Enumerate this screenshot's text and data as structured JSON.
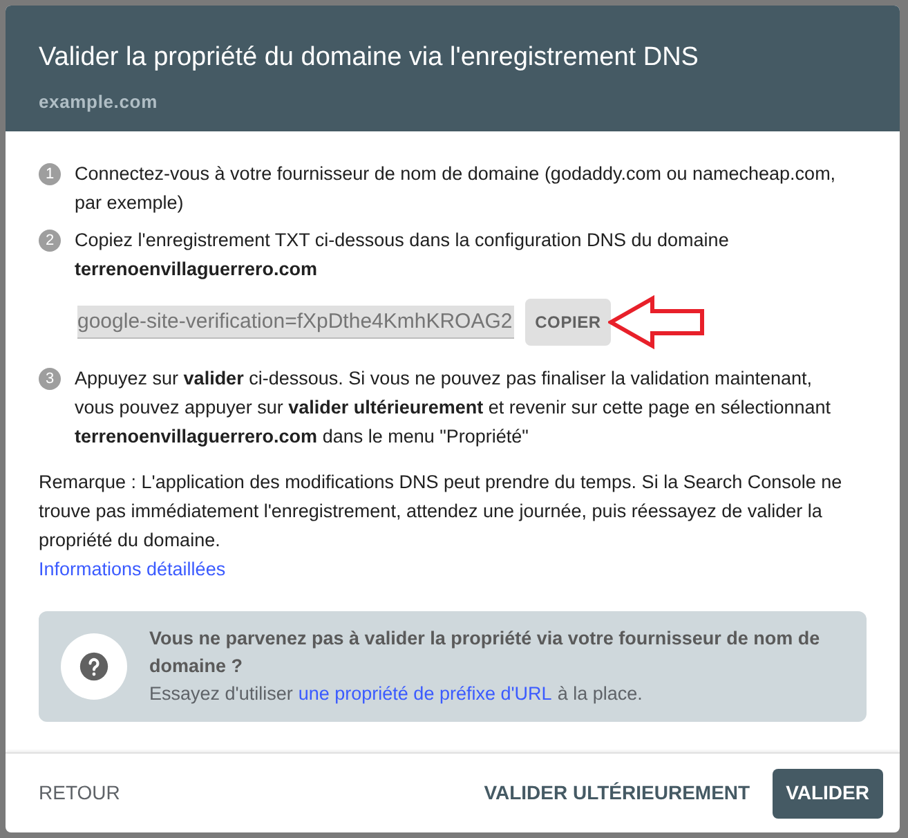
{
  "dialog": {
    "title": "Valider la propriété du domaine via l'enregistrement DNS",
    "subtitle": "example.com"
  },
  "steps": [
    {
      "number": "1",
      "text": "Connectez-vous à votre fournisseur de nom de domaine (godaddy.com ou namecheap.com, par exemple)"
    },
    {
      "number": "2",
      "text": "Copiez l'enregistrement TXT ci-dessous dans la configuration DNS du domaine **terrenoenvillaguerrero.com**",
      "record": "google-site-verification=fXpDthe4KmhKROAG2",
      "copy_button": "COPIER"
    },
    {
      "number": "3",
      "text": "Appuyez sur **valider** ci-dessous. Si vous ne pouvez pas finaliser la validation maintenant, vous pouvez appuyer sur **valider ultérieurement** et revenir sur cette page en sélectionnant **terrenoenvillaguerrero.com** dans le menu \"Propriété\""
    }
  ],
  "note": "Remarque : L'application des modifications DNS peut prendre du temps. Si la Search Console ne trouve pas immédiatement l'enregistrement, attendez une journée, puis réessayez de valider la propriété du domaine.",
  "more_link": "Informations détaillées",
  "help_box": {
    "title": "Vous ne parvenez pas à valider la propriété via votre fournisseur de nom de domaine ?",
    "text_before": "Essayez d'utiliser",
    "link": "une propriété de préfixe d'URL",
    "text_after": "à la place."
  },
  "footer": {
    "back": "RETOUR",
    "later": "VALIDER ULTÉRIEUREMENT",
    "validate": "VALIDER"
  }
}
